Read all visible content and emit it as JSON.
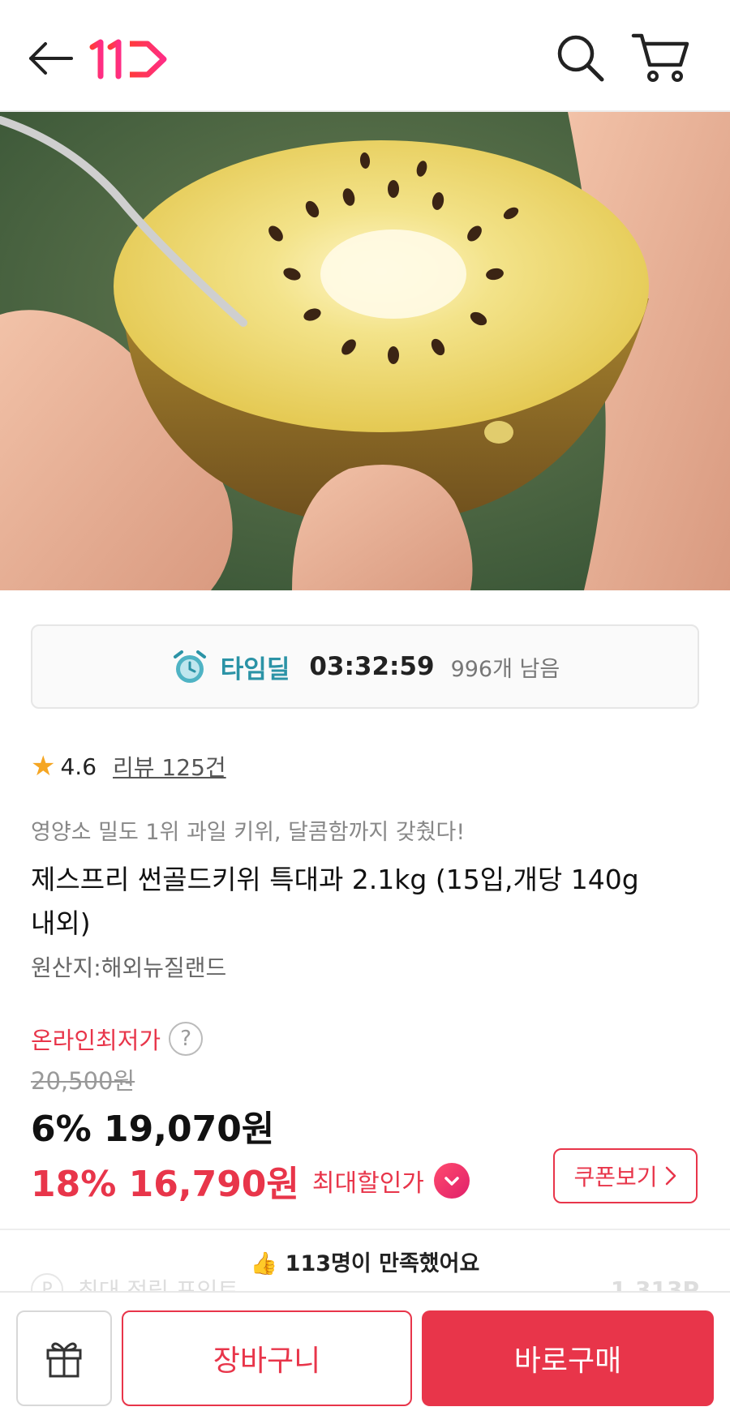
{
  "header": {
    "logo_text": "11",
    "back_icon": "arrow-left-icon",
    "search_icon": "search-icon",
    "cart_icon": "cart-icon"
  },
  "hero": {
    "image": "golden-kiwi-half-being-scooped",
    "slide_count": 3,
    "active_slide": 1
  },
  "time_deal": {
    "label": "타임딜",
    "time": "03:32:59",
    "remaining": "996개 남음"
  },
  "rating": {
    "value": "4.6",
    "review_link": "리뷰 125건"
  },
  "product": {
    "subtitle": "영양소 밀도 1위 과일 키위, 달콤함까지 갖췄다!",
    "title": "제스프리 썬골드키위 특대과 2.1kg (15입,개당 140g내외)",
    "origin": "원산지:해외뉴질랜드"
  },
  "price": {
    "lowest_label": "온라인최저가",
    "help": "?",
    "original": "20,500원",
    "discount1": "6% 19,070원",
    "discount2": "18% 16,790원",
    "max_discount_label": "최대할인가",
    "coupon_button": "쿠폰보기"
  },
  "satisfaction": "👍 113명이 만족했어요",
  "faded_row": {
    "icon": "P",
    "label": "최대 적립 포인트",
    "points": "1,313P"
  },
  "bottom_bar": {
    "gift_icon": "gift-icon",
    "cart_button": "장바구니",
    "buy_button": "바로구매"
  },
  "colors": {
    "accent": "#e8354a",
    "time_deal": "#2b93a6"
  }
}
